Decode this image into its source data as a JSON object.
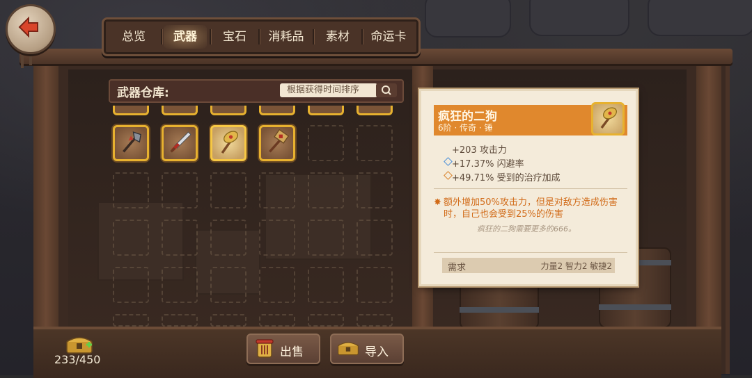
{
  "tabs": [
    {
      "label": "总览",
      "active": false
    },
    {
      "label": "武器",
      "active": true
    },
    {
      "label": "宝石",
      "active": false
    },
    {
      "label": "消耗品",
      "active": false
    },
    {
      "label": "素材",
      "active": false
    },
    {
      "label": "命运卡",
      "active": false
    }
  ],
  "warehouse": {
    "title": "武器仓库:",
    "sort_label": "根据获得时间排序"
  },
  "inventory": {
    "items": [
      {
        "icon": "axe-icon",
        "selected": false
      },
      {
        "icon": "sword-icon",
        "selected": false
      },
      {
        "icon": "hammer-icon",
        "selected": true
      },
      {
        "icon": "mace-icon",
        "selected": false
      }
    ],
    "count": "233/450"
  },
  "detail": {
    "name": "疯狂的二狗",
    "subtitle": "6阶 · 传奇 · 锤",
    "stats": [
      {
        "text": "+203  攻击力",
        "marker": "none"
      },
      {
        "text": "+17.37%  闪避率",
        "marker": "blue-diamond"
      },
      {
        "text": "+49.71%  受到的治疗加成",
        "marker": "orange-diamond"
      }
    ],
    "effect": "额外增加50%攻击力，但是对敌方造成伤害时，自己也会受到25%的伤害",
    "flavor": "疯狂的二狗需要更多的666。",
    "requirement_label": "需求",
    "requirements": "力量2  智力2  敏捷2"
  },
  "buttons": {
    "sell": "出售",
    "import": "导入"
  },
  "colors": {
    "rarity_orange": "#e0882d",
    "effect_text": "#d16a17",
    "frame_gold": "#e7b12f"
  }
}
